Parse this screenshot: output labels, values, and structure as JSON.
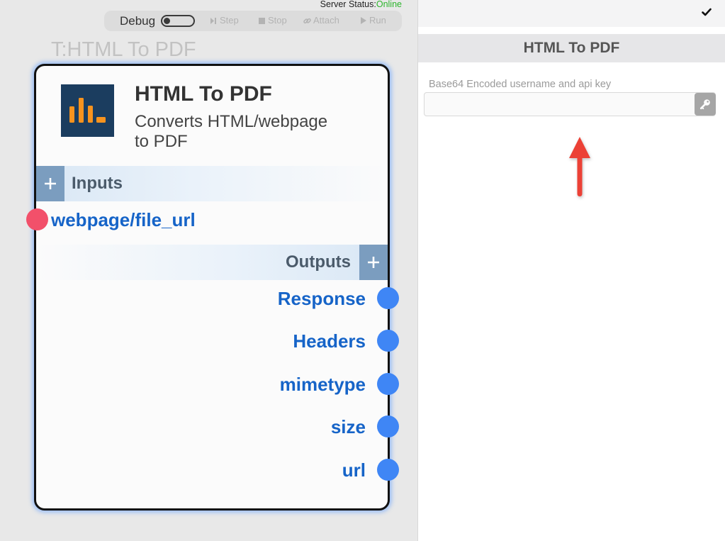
{
  "server_status": {
    "label": "Server Status:",
    "value": "Online"
  },
  "toolbar": {
    "debug_label": "Debug",
    "debug_enabled": false,
    "buttons": [
      {
        "label": "Step",
        "icon": "step-icon"
      },
      {
        "label": "Stop",
        "icon": "stop-icon"
      },
      {
        "label": "Attach",
        "icon": "link-icon"
      },
      {
        "label": "Run",
        "icon": "play-icon"
      }
    ]
  },
  "canvas": {
    "node_caption": "T:HTML To PDF"
  },
  "node": {
    "logo_icon": "bar-chart-logo-icon",
    "title": "HTML To PDF",
    "description": "Converts HTML/webpage to PDF",
    "inputs_header": "Inputs",
    "outputs_header": "Outputs",
    "add_icon": "plus-icon",
    "inputs": [
      {
        "label": "webpage/file_url"
      }
    ],
    "outputs": [
      {
        "label": "Response"
      },
      {
        "label": "Headers"
      },
      {
        "label": "mimetype"
      },
      {
        "label": "size"
      },
      {
        "label": "url"
      }
    ]
  },
  "panel": {
    "confirm_icon": "checkmark-icon",
    "title": "HTML To PDF",
    "fields": [
      {
        "label": "Base64 Encoded username and api key",
        "value": "",
        "icon": "key-icon"
      }
    ]
  },
  "colors": {
    "canvas_bg": "#e8e8e8",
    "status_online": "#2db52d",
    "node_border": "#111111",
    "logo_bg": "#1b3d5f",
    "logo_accent": "#f7931e",
    "section_button": "#7b9dbf",
    "section_tint": "#d9e7f5",
    "port_label": "#1664c8",
    "input_port": "#f2506a",
    "output_port": "#3f86f5",
    "panel_header_bg": "#e6e6e8",
    "key_button": "#a6a6a6",
    "annotation_arrow": "#ec4136"
  }
}
